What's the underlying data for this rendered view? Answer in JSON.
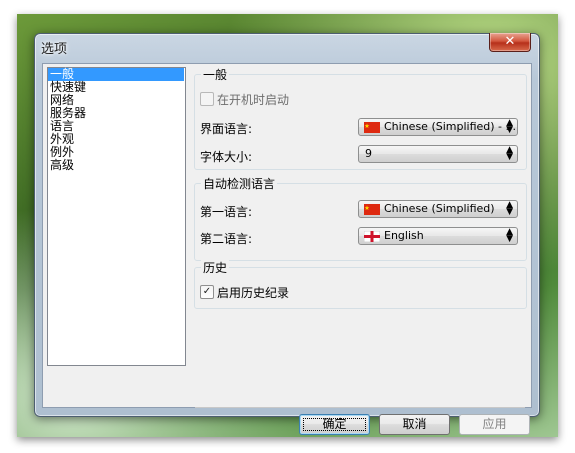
{
  "window": {
    "title": "选项",
    "close_label": "✕"
  },
  "sidebar": {
    "items": [
      {
        "label": "一般",
        "selected": true
      },
      {
        "label": "快速键",
        "selected": false
      },
      {
        "label": "网络",
        "selected": false
      },
      {
        "label": "服务器",
        "selected": false
      },
      {
        "label": "语言",
        "selected": false
      },
      {
        "label": "外观",
        "selected": false
      },
      {
        "label": "例外",
        "selected": false
      },
      {
        "label": "高级",
        "selected": false
      }
    ]
  },
  "general": {
    "title": "一般",
    "startup_label": "在开机时启动",
    "startup_checked": false,
    "ui_language_label": "界面语言:",
    "ui_language_value": "Chinese (Simplified) - ...",
    "font_size_label": "字体大小:",
    "font_size_value": "9"
  },
  "detect": {
    "title": "自动检测语言",
    "first_label": "第一语言:",
    "first_value": "Chinese (Simplified)",
    "second_label": "第二语言:",
    "second_value": "English"
  },
  "history": {
    "title": "历史",
    "enable_label": "启用历史纪录",
    "enable_checked": true
  },
  "buttons": {
    "ok": "确定",
    "cancel": "取消",
    "apply": "应用"
  },
  "icons": {
    "arrow": "⬍",
    "check": "✓",
    "flag_cn_color": "#de2910",
    "flag_cn_star": "#ffde00",
    "flag_uk_color": "#cf142b"
  }
}
